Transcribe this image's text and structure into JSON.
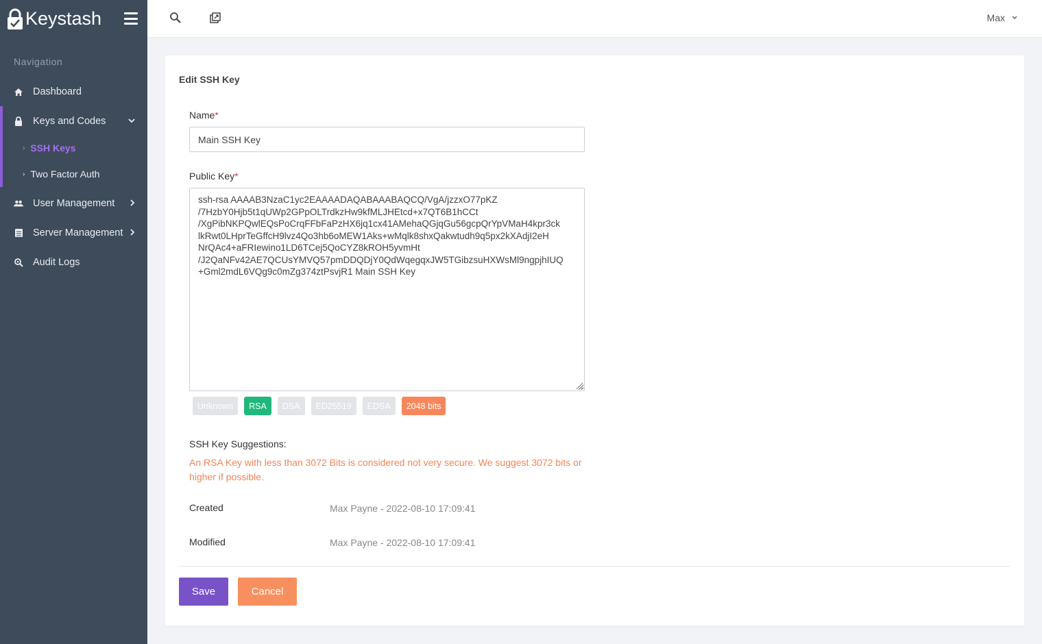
{
  "app": {
    "brand": "Keystash"
  },
  "sidebar": {
    "nav_title": "Navigation",
    "items": [
      {
        "label": "Dashboard",
        "icon": "home-icon"
      },
      {
        "label": "Keys and Codes",
        "icon": "lock-icon"
      },
      {
        "label": "User Management",
        "icon": "users-icon"
      },
      {
        "label": "Server Management",
        "icon": "server-icon"
      },
      {
        "label": "Audit Logs",
        "icon": "search-zoom-icon"
      }
    ],
    "sub_items": [
      {
        "label": "SSH Keys",
        "active": true
      },
      {
        "label": "Two Factor Auth",
        "active": false
      }
    ],
    "active_color": "#a66ff0"
  },
  "topbar": {
    "user_name": "Max"
  },
  "form": {
    "title": "Edit SSH Key",
    "name_label": "Name",
    "required_mark": "*",
    "name_value": "Main SSH Key",
    "public_key_label": "Public Key",
    "public_key_value": "ssh-rsa AAAAB3NzaC1yc2EAAAADAQABAAABAQCQ/VgA/jzzxO77pKZ\n/7HzbY0Hjb5t1qUWp2GPpOLTrdkzHw9kfMLJHEtcd+x7QT6B1hCCt\n/XgPibNKPQwlEQsPoCrqFFbFaPzHX6jq1cx41AMehaQGjqGu56gcpQrYpVMaH4kpr3ck\nlkRwt0LHprTeGffcH9lvz4Qo3hb6oMEW1Aks+wMqlk8shxQakwtudh9q5px2kXAdjI2eH\nNrQAc4+aFRIewino1LD6TCej5QoCYZ8kROH5yvmHt\n/J2QaNFv42AE7QCUsYMVQ57pmDDQDjY0QdWqegqxJW5TGibzsuHXWsMl9ngpjhIUQ\n+Gml2mdL6VQg9c0mZg374ztPsvjR1 Main SSH Key",
    "key_types": [
      {
        "label": "Unknown",
        "active": false
      },
      {
        "label": "RSA",
        "active": true
      },
      {
        "label": "DSA",
        "active": false
      },
      {
        "label": "ED25519",
        "active": false
      },
      {
        "label": "EDSA",
        "active": false
      }
    ],
    "bits_badge": "2048 bits",
    "suggestions_title": "SSH Key Suggestions:",
    "suggestion_text": "An RSA Key with less than 3072 Bits is considered not very secure. We suggest 3072 bits or higher if possible.",
    "created_label": "Created",
    "created_value": "Max Payne - 2022-08-10 17:09:41",
    "modified_label": "Modified",
    "modified_value": "Max Payne - 2022-08-10 17:09:41",
    "save_label": "Save",
    "cancel_label": "Cancel"
  },
  "colors": {
    "sidebar_bg": "#3e4b5b",
    "accent_purple": "#7952c8",
    "rsa_green": "#1fb87a",
    "warning_orange": "#f7875a"
  }
}
